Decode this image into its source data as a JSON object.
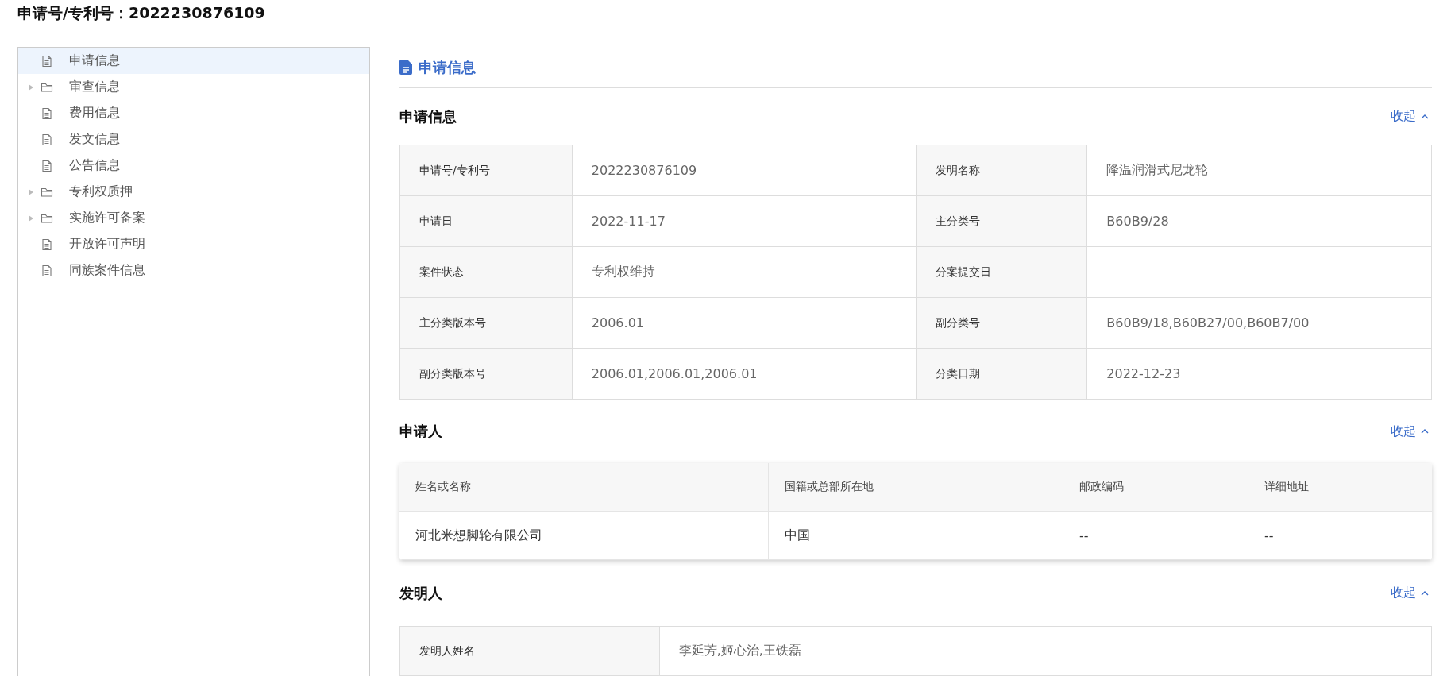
{
  "page_title": "申请号/专利号：2022230876109",
  "sidebar": {
    "items": [
      {
        "label": "申请信息",
        "kind": "file",
        "selected": true
      },
      {
        "label": "审查信息",
        "kind": "folder",
        "selected": false,
        "expanded": false
      },
      {
        "label": "费用信息",
        "kind": "file",
        "selected": false
      },
      {
        "label": "发文信息",
        "kind": "file",
        "selected": false
      },
      {
        "label": "公告信息",
        "kind": "file",
        "selected": false
      },
      {
        "label": "专利权质押",
        "kind": "folder",
        "selected": false,
        "expanded": false
      },
      {
        "label": "实施许可备案",
        "kind": "folder",
        "selected": false,
        "expanded": false
      },
      {
        "label": "开放许可声明",
        "kind": "file",
        "selected": false
      },
      {
        "label": "同族案件信息",
        "kind": "file",
        "selected": false
      }
    ]
  },
  "content_heading": "申请信息",
  "sections": [
    {
      "kind": "fields",
      "title": "申请信息",
      "toggle": "收起",
      "expanded": true,
      "rows": [
        [
          {
            "label": "申请号/专利号",
            "value": "2022230876109"
          },
          {
            "label": "发明名称",
            "value": "降温润滑式尼龙轮"
          }
        ],
        [
          {
            "label": "申请日",
            "value": "2022-11-17"
          },
          {
            "label": "主分类号",
            "value": "B60B9/28"
          }
        ],
        [
          {
            "label": "案件状态",
            "value": "专利权维持"
          },
          {
            "label": "分案提交日"
          }
        ],
        [
          {
            "label": "主分类版本号",
            "value": "2006.01"
          },
          {
            "label": "副分类号",
            "value": "B60B9/18,B60B27/00,B60B7/00"
          }
        ],
        [
          {
            "label": "副分类版本号",
            "value": "2006.01,2006.01,2006.01"
          },
          {
            "label": "分类日期",
            "value": "2022-12-23"
          }
        ]
      ]
    },
    {
      "kind": "table",
      "title": "申请人",
      "toggle": "收起",
      "expanded": true,
      "columns": [
        "姓名或名称",
        "国籍或总部所在地",
        "邮政编码",
        "详细地址"
      ],
      "rows": [
        [
          "河北米想脚轮有限公司",
          "中国",
          "--",
          "--"
        ]
      ]
    },
    {
      "kind": "fields",
      "title": "发明人",
      "toggle": "收起",
      "expanded": true,
      "rows": [
        [
          {
            "label": "发明人姓名",
            "value": "李延芳,姬心治,王铁磊"
          }
        ]
      ]
    }
  ]
}
